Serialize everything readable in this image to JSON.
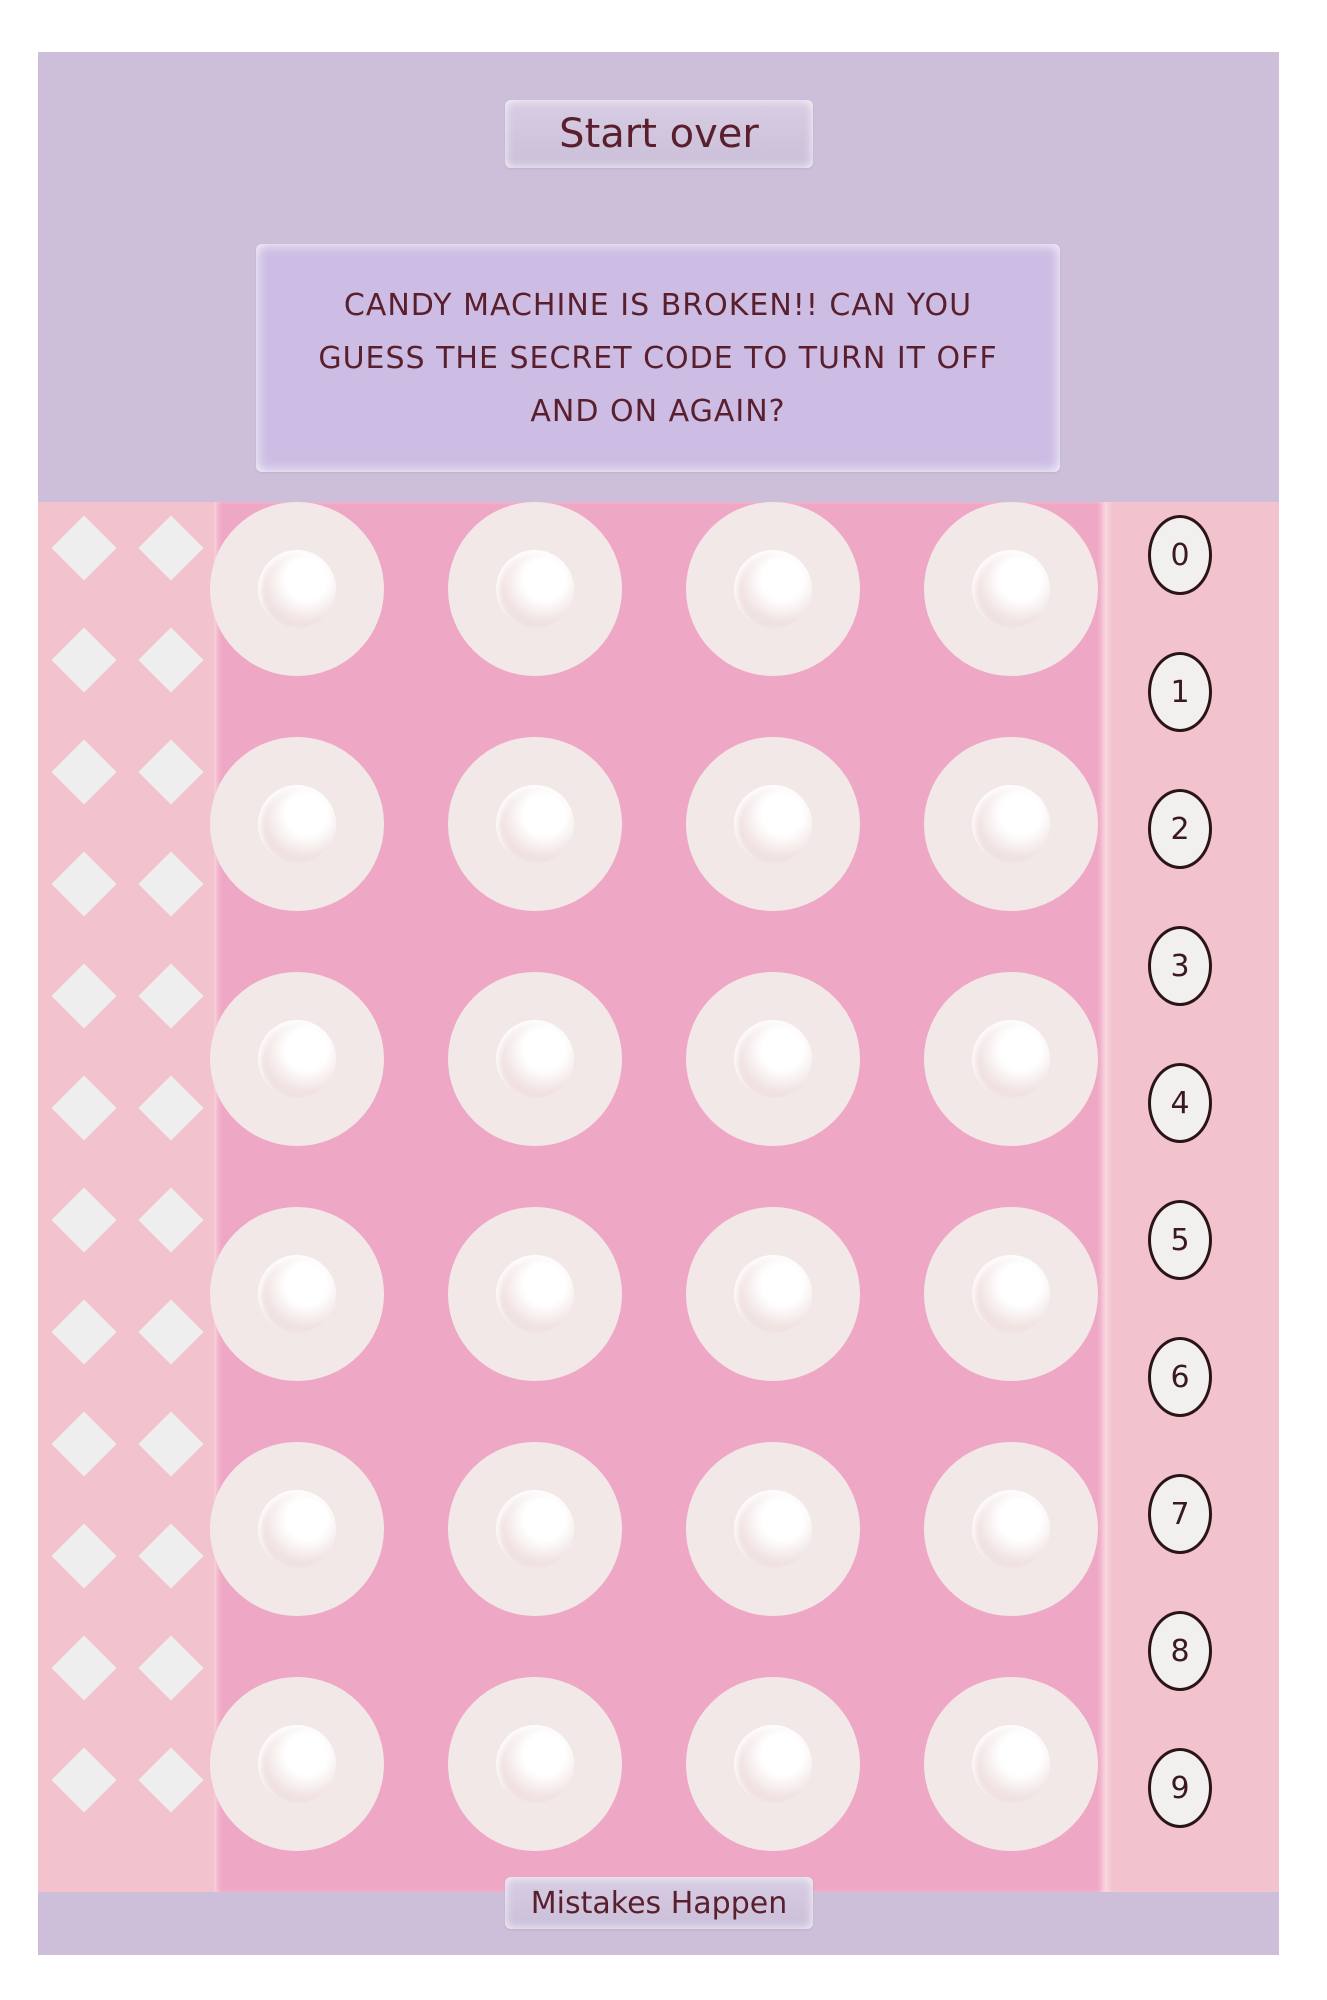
{
  "header": {
    "start_over_label": "Start over"
  },
  "message": {
    "text": "CANDY MACHINE IS BROKEN!! CAN YOU GUESS THE SECRET CODE TO TURN IT OFF AND ON AGAIN?"
  },
  "keypad": {
    "digits": [
      "0",
      "1",
      "2",
      "3",
      "4",
      "5",
      "6",
      "7",
      "8",
      "9"
    ]
  },
  "board": {
    "rows": 6,
    "columns": 4
  },
  "footer": {
    "mistakes_label": "Mistakes Happen"
  },
  "colors": {
    "machine": "#cdbfda",
    "message_box": "#cdbde4",
    "board": "#eea7c4",
    "side_panel": "#f2c2cd",
    "hole": "#f3e8e8",
    "text": "#5a1f2c"
  }
}
